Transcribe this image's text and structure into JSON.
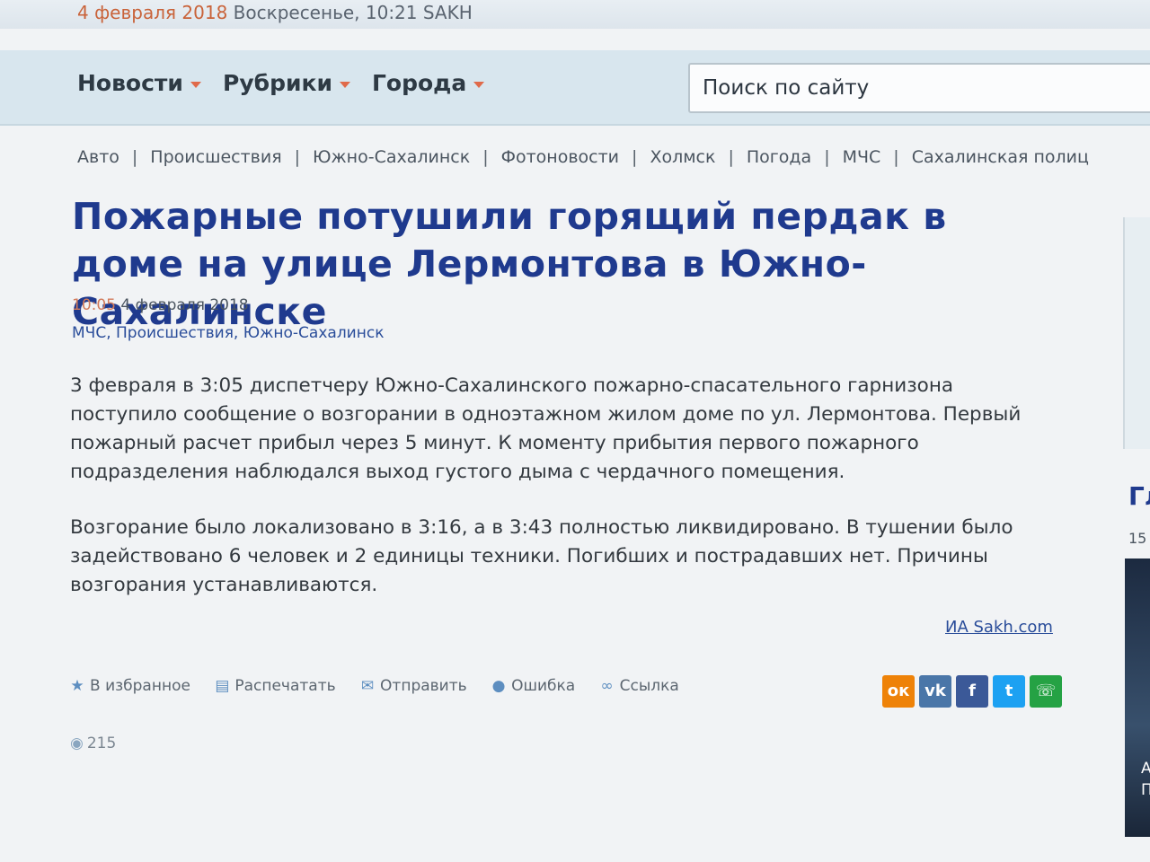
{
  "datebar": {
    "date": "4 февраля 2018",
    "rest": " Воскресенье, 10:21 SAKH"
  },
  "nav": {
    "items": [
      {
        "label": "Новости"
      },
      {
        "label": "Рубрики"
      },
      {
        "label": "Города"
      }
    ],
    "search_placeholder": "Поиск по сайту"
  },
  "rubrics": [
    "Авто",
    "Происшествия",
    "Южно-Сахалинск",
    "Фотоновости",
    "Холмск",
    "Погода",
    "МЧС",
    "Сахалинская полиц"
  ],
  "article": {
    "title": "Пожарные потушили горящий пердак в доме на улице Лермонтова в Южно-Сахалинске",
    "time": "10:05",
    "date": " 4 февраля 2018",
    "tags": "МЧС, Происшествия, Южно-Сахалинск",
    "paragraphs": [
      "3 февраля в 3:05 диспетчеру Южно-Сахалинского пожарно-спасательного гарнизона поступило сообщение о возгорании в одноэтажном жилом доме по ул. Лермонтова. Первый пожарный расчет прибыл через 5 минут. К моменту прибытия первого пожарного подразделения наблюдался выход густого дыма с чердачного помещения.",
      "Возгорание было локализовано в 3:16, а в 3:43 полностью ликвидировано. В тушении было задействовано 6 человек и 2 единицы техники. Погибших и пострадавших нет. Причины возгорания устанавливаются."
    ],
    "source": "ИА Sakh.com"
  },
  "actions": {
    "favorite": "В избранное",
    "print": "Распечатать",
    "send": "Отправить",
    "error": "Ошибка",
    "link": "Ссылка"
  },
  "share": [
    {
      "icon": "odnoklassniki-icon",
      "glyph": "ок",
      "color": "#ee8208"
    },
    {
      "icon": "vk-icon",
      "glyph": "vk",
      "color": "#4a76a8"
    },
    {
      "icon": "facebook-icon",
      "glyph": "f",
      "color": "#3b5998"
    },
    {
      "icon": "twitter-icon",
      "glyph": "t",
      "color": "#1da1f2"
    },
    {
      "icon": "whatsapp-icon",
      "glyph": "☏",
      "color": "#25a244"
    }
  ],
  "views": "215",
  "right": {
    "heading": "Гл",
    "number": "15",
    "caption1": "А",
    "caption2": "П"
  }
}
